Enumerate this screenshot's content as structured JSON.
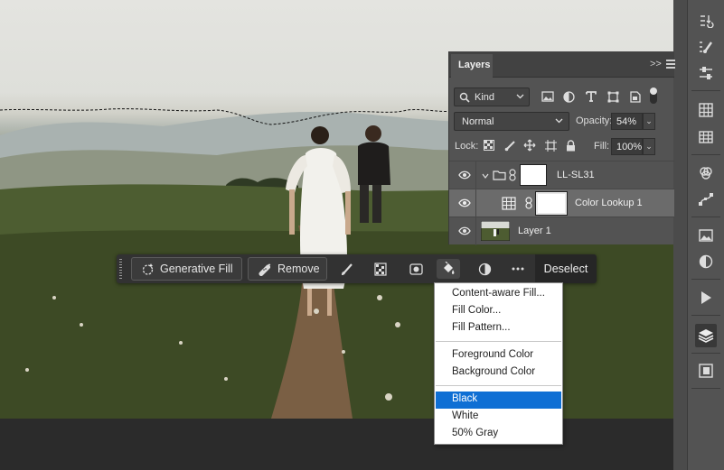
{
  "layers_panel": {
    "tab_label": "Layers",
    "collapse_label": ">>",
    "filter_kind_label": "Kind",
    "blend_mode": "Normal",
    "opacity_label": "Opacity:",
    "opacity_value": "54%",
    "lock_label": "Lock:",
    "fill_label": "Fill:",
    "fill_value": "100%",
    "layers": [
      {
        "name": "LL-SL31",
        "type": "group"
      },
      {
        "name": "Color Lookup 1",
        "type": "adjustment"
      },
      {
        "name": "Layer 1",
        "type": "pixel"
      }
    ]
  },
  "taskbar": {
    "generative_fill_label": "Generative Fill",
    "remove_label": "Remove",
    "deselect_label": "Deselect",
    "icons": [
      "brush-icon",
      "mask-icon",
      "selection-to-mask-icon",
      "fill-bucket-icon",
      "invert-icon",
      "more-icon"
    ]
  },
  "fill_menu": {
    "items": [
      "Content-aware Fill...",
      "Fill Color...",
      "Fill Pattern...",
      "Foreground Color",
      "Background Color",
      "Black",
      "White",
      "50% Gray"
    ],
    "highlighted": "Black"
  },
  "right_toolbar": {
    "icons": [
      "history-icon",
      "brush-settings-icon",
      "adjust-icon",
      "grid-icon",
      "table-icon",
      "channels-icon",
      "paths-icon",
      "image-icon",
      "adjustments-icon",
      "play-icon",
      "layers-icon",
      "libraries-icon"
    ]
  },
  "colors": {
    "panel_bg": "#535353",
    "taskbar_bg": "#323232",
    "highlight": "#0f6fd4"
  }
}
